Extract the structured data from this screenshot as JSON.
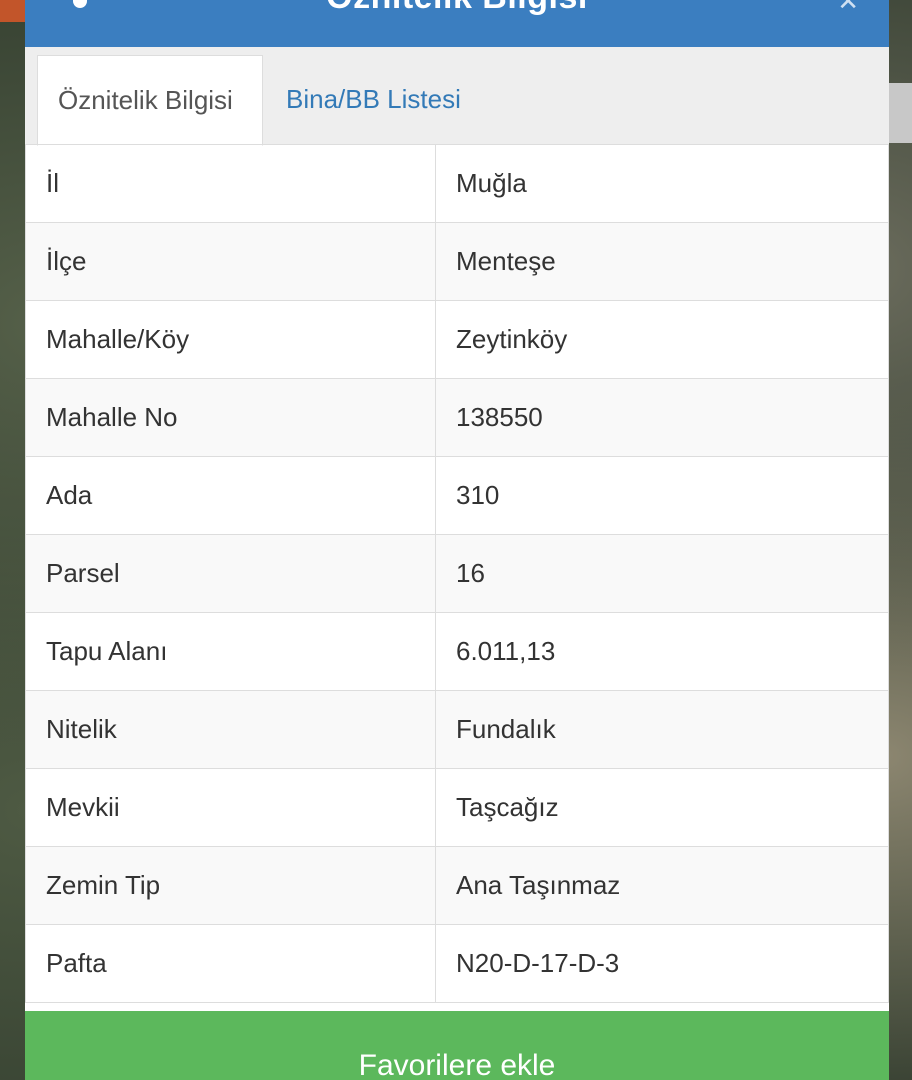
{
  "header": {
    "title": "Öznitelik Bilgisi",
    "close_icon": "close-icon"
  },
  "tabs": [
    {
      "label": "Öznitelik Bilgisi",
      "active": true
    },
    {
      "label": "Bina/BB Listesi",
      "active": false
    }
  ],
  "attributes": [
    {
      "key": "İl",
      "value": "Muğla"
    },
    {
      "key": "İlçe",
      "value": "Menteşe"
    },
    {
      "key": "Mahalle/Köy",
      "value": "Zeytinköy"
    },
    {
      "key": "Mahalle No",
      "value": "138550"
    },
    {
      "key": "Ada",
      "value": "310"
    },
    {
      "key": "Parsel",
      "value": "16"
    },
    {
      "key": "Tapu Alanı",
      "value": "6.011,13"
    },
    {
      "key": "Nitelik",
      "value": "Fundalık"
    },
    {
      "key": "Mevkii",
      "value": "Taşcağız"
    },
    {
      "key": "Zemin Tip",
      "value": "Ana Taşınmaz"
    },
    {
      "key": "Pafta",
      "value": "N20-D-17-D-3"
    }
  ],
  "actions": {
    "favorite_label": "Favorilere ekle"
  },
  "colors": {
    "header": "#3b7ec0",
    "tab_link": "#337ab7",
    "button": "#5cb85c"
  }
}
